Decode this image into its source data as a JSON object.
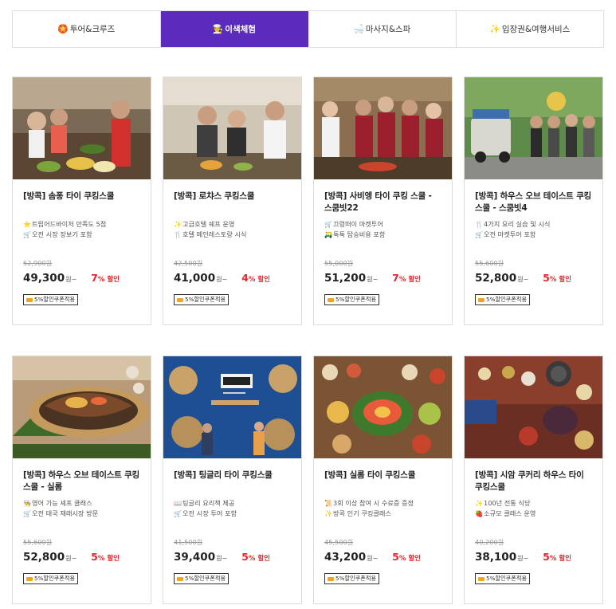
{
  "tabs": [
    {
      "icon": "🏵️",
      "icon_name": "cruise-icon",
      "label": "투어&크루즈",
      "active": false
    },
    {
      "icon": "🧑‍🍳",
      "icon_name": "experience-icon",
      "label": "이색체험",
      "active": true
    },
    {
      "icon": "🛁",
      "icon_name": "spa-icon",
      "label": "마사지&스파",
      "active": false
    },
    {
      "icon": "✨",
      "icon_name": "sparkle-icon",
      "label": "입장권&여행서비스",
      "active": false
    }
  ],
  "colors": {
    "accent": "#5b2bbd",
    "discount": "#e3272d",
    "coupon_icon": "#f2a51c"
  },
  "cards": [
    {
      "title": "[방콕] 솜퐁 타이 쿠킹스쿨",
      "features": [
        {
          "icon": "⭐",
          "icon_name": "star-icon",
          "text": "트립어드바이저 만족도 5점"
        },
        {
          "icon": "🛒",
          "icon_name": "cart-icon",
          "text": "오전 시장 장보기 포함"
        }
      ],
      "original_price": "52,900원",
      "price": "49,300",
      "won": "원~",
      "discount": "7",
      "discount_label": "% 할인",
      "coupon": "5%할인쿠폰적용"
    },
    {
      "title": "[방콕] 로챠스 쿠킹스쿨",
      "features": [
        {
          "icon": "✨",
          "icon_name": "sparkle-icon",
          "text": "고급호텔 쉐프 운영"
        },
        {
          "icon": "🍴",
          "icon_name": "fork-knife-icon",
          "text": "호텔 메인레스토랑 시식"
        }
      ],
      "original_price": "42,500원",
      "price": "41,000",
      "won": "원~",
      "discount": "4",
      "discount_label": "% 할인",
      "coupon": "5%할인쿠폰적용"
    },
    {
      "title": "[방콕] 사비엥 타이 쿠킹 스쿨 - 스쿰빗22",
      "features": [
        {
          "icon": "🛒",
          "icon_name": "cart-icon",
          "text": "끄렁떠이 마켓투어"
        },
        {
          "icon": "🛺",
          "icon_name": "tuktuk-icon",
          "text": "툭툭 탑승비용 포함"
        }
      ],
      "original_price": "55,000원",
      "price": "51,200",
      "won": "원~",
      "discount": "7",
      "discount_label": "% 할인",
      "coupon": "5%할인쿠폰적용"
    },
    {
      "title": "[방콕] 하우스 오브 테이스트 쿠킹 스쿨 - 스쿰빗4",
      "features": [
        {
          "icon": "🍴",
          "icon_name": "fork-knife-icon",
          "text": "4가지 요리 실습 및 시식"
        },
        {
          "icon": "🛒",
          "icon_name": "cart-icon",
          "text": "오전 마켓투어 포함"
        }
      ],
      "original_price": "55,600원",
      "price": "52,800",
      "won": "원~",
      "discount": "5",
      "discount_label": "% 할인",
      "coupon": "5%할인쿠폰적용"
    },
    {
      "title": "[방콕] 하우스 오브 테이스트 쿠킹 스쿨 - 실롬",
      "features": [
        {
          "icon": "👨‍🍳",
          "icon_name": "chef-icon",
          "text": "영어 가능 셰프 클래스"
        },
        {
          "icon": "🛒",
          "icon_name": "cart-icon",
          "text": "오전 태국 재래시장 방문"
        }
      ],
      "original_price": "55,600원",
      "price": "52,800",
      "won": "원~",
      "discount": "5",
      "discount_label": "% 할인",
      "coupon": "5%할인쿠폰적용"
    },
    {
      "title": "[방콕] 팅글리 타이 쿠킹스쿨",
      "features": [
        {
          "icon": "📖",
          "icon_name": "book-icon",
          "text": "팅글리 요리책 제공"
        },
        {
          "icon": "🛒",
          "icon_name": "cart-icon",
          "text": "오전 시장 투어 포함"
        }
      ],
      "original_price": "41,500원",
      "price": "39,400",
      "won": "원~",
      "discount": "5",
      "discount_label": "% 할인",
      "coupon": "5%할인쿠폰적용"
    },
    {
      "title": "[방콕] 실롬 타이 쿠킹스쿨",
      "features": [
        {
          "icon": "📜",
          "icon_name": "certificate-icon",
          "text": "3회 이상 참여 시 수료증 증정"
        },
        {
          "icon": "✨",
          "icon_name": "sparkle-icon",
          "text": "방콕 인기 쿠킹클래스"
        }
      ],
      "original_price": "45,500원",
      "price": "43,200",
      "won": "원~",
      "discount": "5",
      "discount_label": "% 할인",
      "coupon": "5%할인쿠폰적용"
    },
    {
      "title": "[방콕] 시암 쿠커리 하우스 타이 쿠킹스쿨",
      "features": [
        {
          "icon": "✨",
          "icon_name": "sparkle-icon",
          "text": "100년 전통 식당"
        },
        {
          "icon": "🍓",
          "icon_name": "strawberry-icon",
          "text": "소규모 클래스 운영"
        }
      ],
      "original_price": "40,200원",
      "price": "38,100",
      "won": "원~",
      "discount": "5",
      "discount_label": "% 할인",
      "coupon": "5%할인쿠폰적용"
    }
  ]
}
